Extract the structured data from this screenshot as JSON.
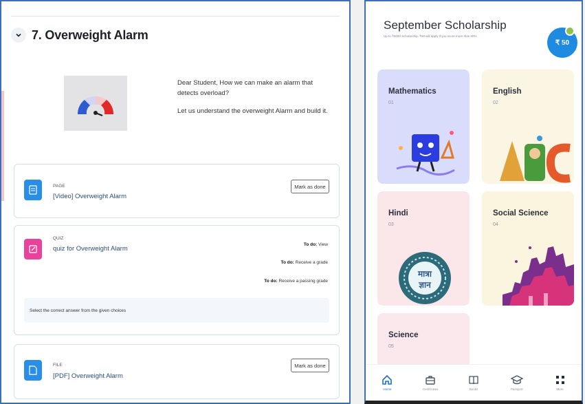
{
  "course": {
    "section_title": "7. Overweight Alarm",
    "intro_line1": "Dear Student, How we can make an alarm that detects overload?",
    "intro_line2": "Let us understand the overweight Alarm and build it.",
    "activities": [
      {
        "type": "PAGE",
        "name": "[Video] Overweight Alarm",
        "button": "Mark as done",
        "icon": "page-icon",
        "color": "#2a8ee6"
      },
      {
        "type": "QUIZ",
        "name": "quiz for Overweight Alarm",
        "icon": "quiz-icon",
        "color": "#e8439a",
        "requirements": [
          {
            "label": "To do:",
            "text": "View"
          },
          {
            "label": "To do:",
            "text": "Receive a grade"
          },
          {
            "label": "To do:",
            "text": "Receive a passing grade"
          }
        ],
        "note": "Select the correct answer from the given choices"
      },
      {
        "type": "FILE",
        "name": "[PDF] Overweight Alarm",
        "button": "Mark as done",
        "icon": "file-icon",
        "color": "#2a8ee6"
      }
    ]
  },
  "app": {
    "title": "September Scholarship",
    "subtitle": "Up to ₹5000 Scholarship. ₹50 will apply if you score more than 80%",
    "coin_label": "₹ 50",
    "subjects": [
      {
        "name": "Mathematics",
        "number": "01",
        "bg": "#d9dcfb"
      },
      {
        "name": "English",
        "number": "02",
        "bg": "#fbf6e4"
      },
      {
        "name": "Hindi",
        "number": "03",
        "bg": "#fbe6ea"
      },
      {
        "name": "Social Science",
        "number": "04",
        "bg": "#fbf4df"
      },
      {
        "name": "Science",
        "number": "05",
        "bg": "#fbe8ec"
      }
    ],
    "hindi_badge_line1": "मात्रा",
    "hindi_badge_line2": "ज्ञान",
    "nav": [
      {
        "label": "Home",
        "icon": "home-icon",
        "active": true
      },
      {
        "label": "Certificates",
        "icon": "briefcase-icon",
        "active": false
      },
      {
        "label": "Books",
        "icon": "book-icon",
        "active": false
      },
      {
        "label": "Passport",
        "icon": "graduation-cap-icon",
        "active": false
      },
      {
        "label": "More",
        "icon": "grid-icon",
        "active": false
      }
    ]
  }
}
